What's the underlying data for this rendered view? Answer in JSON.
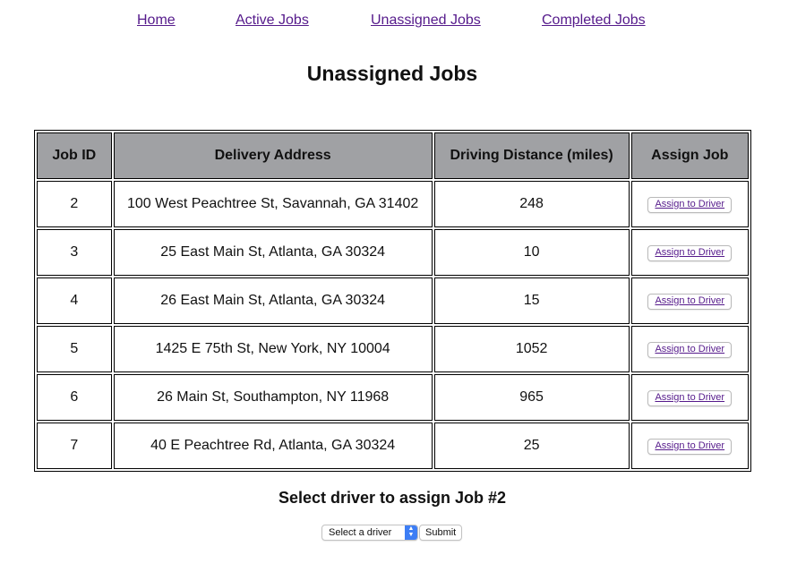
{
  "nav": {
    "home": "Home",
    "active_jobs": "Active Jobs",
    "unassigned_jobs": "Unassigned Jobs",
    "completed_jobs": "Completed Jobs"
  },
  "page_title": "Unassigned Jobs",
  "table": {
    "headers": {
      "job_id": "Job ID",
      "delivery_address": "Delivery Address",
      "driving_distance": "Driving Distance (miles)",
      "assign_job": "Assign Job"
    },
    "rows": [
      {
        "job_id": "2",
        "address": "100 West Peachtree St, Savannah, GA 31402",
        "distance": "248",
        "action": "Assign to Driver"
      },
      {
        "job_id": "3",
        "address": "25 East Main St, Atlanta, GA 30324",
        "distance": "10",
        "action": "Assign to Driver"
      },
      {
        "job_id": "4",
        "address": "26 East Main St, Atlanta, GA 30324",
        "distance": "15",
        "action": "Assign to Driver"
      },
      {
        "job_id": "5",
        "address": "1425 E 75th St, New York, NY 10004",
        "distance": "1052",
        "action": "Assign to Driver"
      },
      {
        "job_id": "6",
        "address": "26 Main St, Southampton, NY 11968",
        "distance": "965",
        "action": "Assign to Driver"
      },
      {
        "job_id": "7",
        "address": "40 E Peachtree Rd, Atlanta, GA 30324",
        "distance": "25",
        "action": "Assign to Driver"
      }
    ]
  },
  "assign_form": {
    "title": "Select driver to assign Job #2",
    "select_value": "Select a driver",
    "submit_label": "Submit"
  },
  "colors": {
    "link": "#551A8B",
    "header_bg": "#a0a1a4",
    "select_accent": "#3d7ef5"
  }
}
